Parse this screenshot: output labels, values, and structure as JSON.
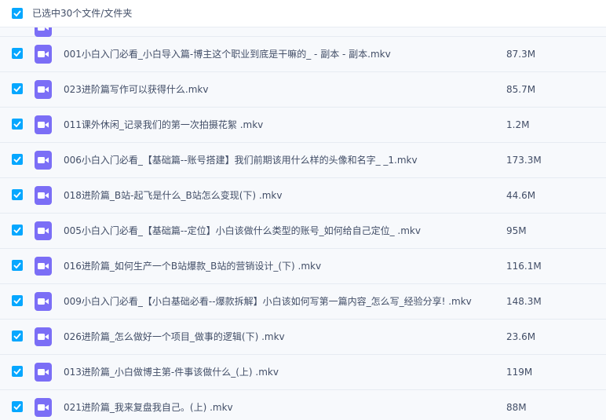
{
  "header": {
    "selection_label": "已选中30个文件/文件夹",
    "checked": true
  },
  "colors": {
    "checkbox": "#06a7ff",
    "file_icon": "#7b6ef6",
    "text": "#424e67",
    "row_bg": "#f7f9fc"
  },
  "file_icon_name": "video-file-icon",
  "files": [
    {
      "name": "001小白入门必看_小白导入篇-博主这个职业到底是干嘛的_ - 副本 - 副本.mkv",
      "size": "87.3M",
      "checked": true
    },
    {
      "name": "023进阶篇写作可以获得什么.mkv",
      "size": "85.7M",
      "checked": true
    },
    {
      "name": "011课外休闲_记录我们的第一次拍摄花絮 .mkv",
      "size": "1.2M",
      "checked": true
    },
    {
      "name": "006小白入门必看_【基础篇--账号搭建】我们前期该用什么样的头像和名字_ _1.mkv",
      "size": "173.3M",
      "checked": true
    },
    {
      "name": "018进阶篇_B站-起飞是什么_B站怎么变现(下) .mkv",
      "size": "44.6M",
      "checked": true
    },
    {
      "name": "005小白入门必看_【基础篇--定位】小白该做什么类型的账号_如何给自己定位_ .mkv",
      "size": "95M",
      "checked": true
    },
    {
      "name": "016进阶篇_如何生产一个B站爆款_B站的营销设计_(下) .mkv",
      "size": "116.1M",
      "checked": true
    },
    {
      "name": "009小白入门必看_【小白基础必看--爆款拆解】小白该如何写第一篇内容_怎么写_经验分享! .mkv",
      "size": "148.3M",
      "checked": true
    },
    {
      "name": "026进阶篇_怎么做好一个项目_做事的逻辑(下) .mkv",
      "size": "23.6M",
      "checked": true
    },
    {
      "name": "013进阶篇_小白做博主第-件事该做什么_(上) .mkv",
      "size": "119M",
      "checked": true
    },
    {
      "name": "021进阶篇_我来复盘我自己。(上) .mkv",
      "size": "88M",
      "checked": true
    }
  ]
}
